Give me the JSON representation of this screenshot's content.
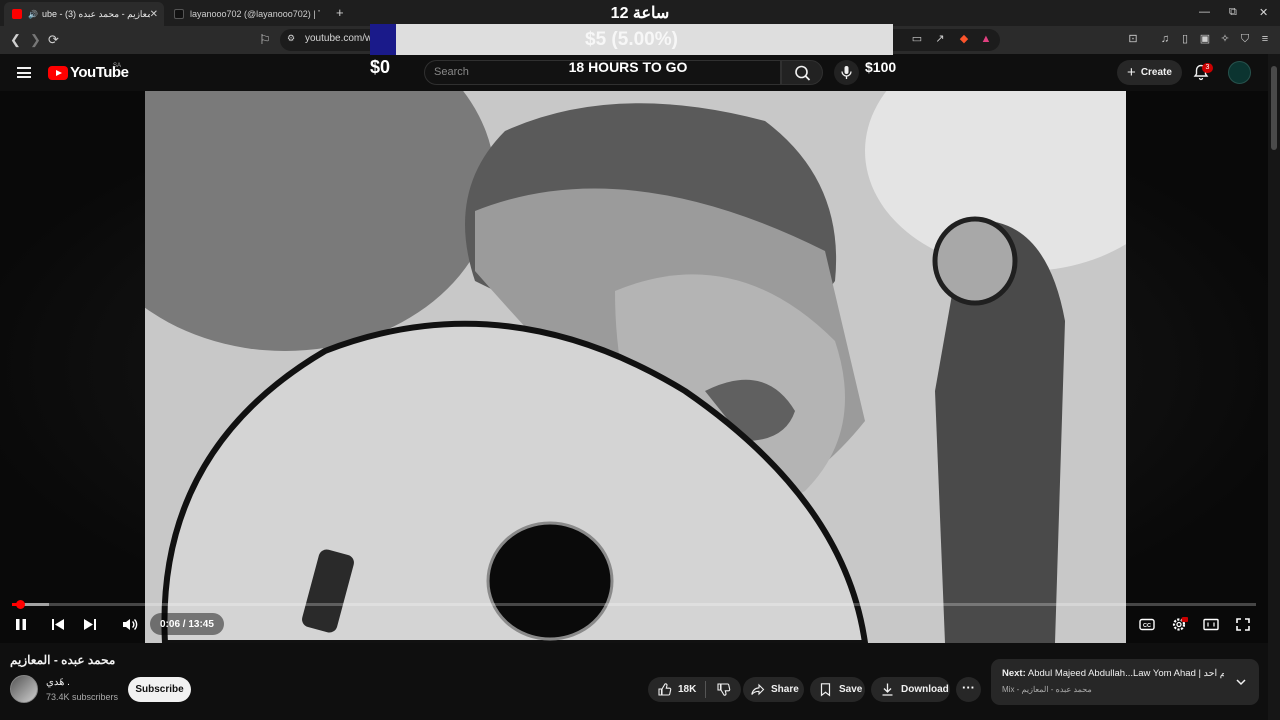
{
  "browser": {
    "tabs": [
      {
        "label": "ube - المعازيم - محمد عبده (3)",
        "active": true
      },
      {
        "label": "layanooo702 (@layanooo702) | TikTo",
        "active": false
      }
    ],
    "url": "youtube.com/w"
  },
  "overlay": {
    "hours": "12 ساعة",
    "progress_label": "$5 (5.00%)",
    "progress_percent": 5.0,
    "countdown": "18 HOURS TO GO",
    "min_label": "$0",
    "max_label": "$100"
  },
  "youtube": {
    "logo_text": "YouTube",
    "country_code": "SA",
    "search_placeholder": "Search",
    "create_label": "Create",
    "notification_count": "3"
  },
  "player": {
    "time_display": "0:06 / 13:45",
    "played_fraction": 0.007,
    "buffered_fraction": 0.03
  },
  "video": {
    "title": "محمد عبده - المعازيم",
    "channel_name": "هَدي .",
    "subscribers": "73.4K subscribers",
    "subscribe_label": "Subscribe",
    "like_count": "18K",
    "share_label": "Share",
    "save_label": "Save",
    "download_label": "Download"
  },
  "up_next": {
    "prefix": "Next:",
    "title": "Abdul Majeed Abdullah...Law Yom Ahad | ـم احد",
    "subtitle": "Mix - محمد عبده - المعازيم"
  },
  "colors": {
    "accent_red": "#ff0000",
    "overlay_fill": "#1a1a8a"
  }
}
